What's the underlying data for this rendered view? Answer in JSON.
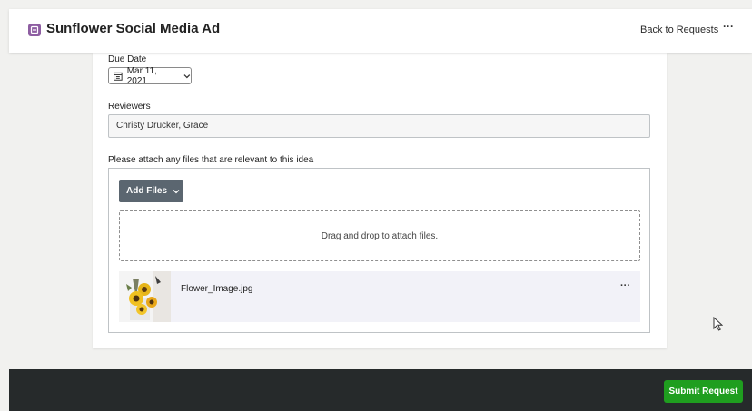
{
  "header": {
    "title": "Sunflower Social Media Ad",
    "back_link": "Back to Requests",
    "more": "···"
  },
  "form": {
    "due_date": {
      "label": "Due Date",
      "value": "Mar 11, 2021"
    },
    "reviewers": {
      "label": "Reviewers",
      "value": "Christy Drucker, Grace"
    },
    "attachments": {
      "label": "Please attach any files that are relevant to this idea",
      "add_files_button": "Add Files",
      "dropzone_text": "Drag and drop to attach files.",
      "files": [
        {
          "name": "Flower_Image.jpg",
          "more": "···"
        }
      ]
    }
  },
  "footer": {
    "submit_button": "Submit Request"
  },
  "colors": {
    "app_icon": "#8e5ea2",
    "add_files_button": "#5b6670",
    "submit_button": "#1f9e1f",
    "footer_bg": "#262a2b"
  },
  "icons": [
    "request-app-icon",
    "calendar-icon",
    "chevron-down-icon",
    "more-horizontal-icon",
    "mouse-cursor-icon"
  ]
}
